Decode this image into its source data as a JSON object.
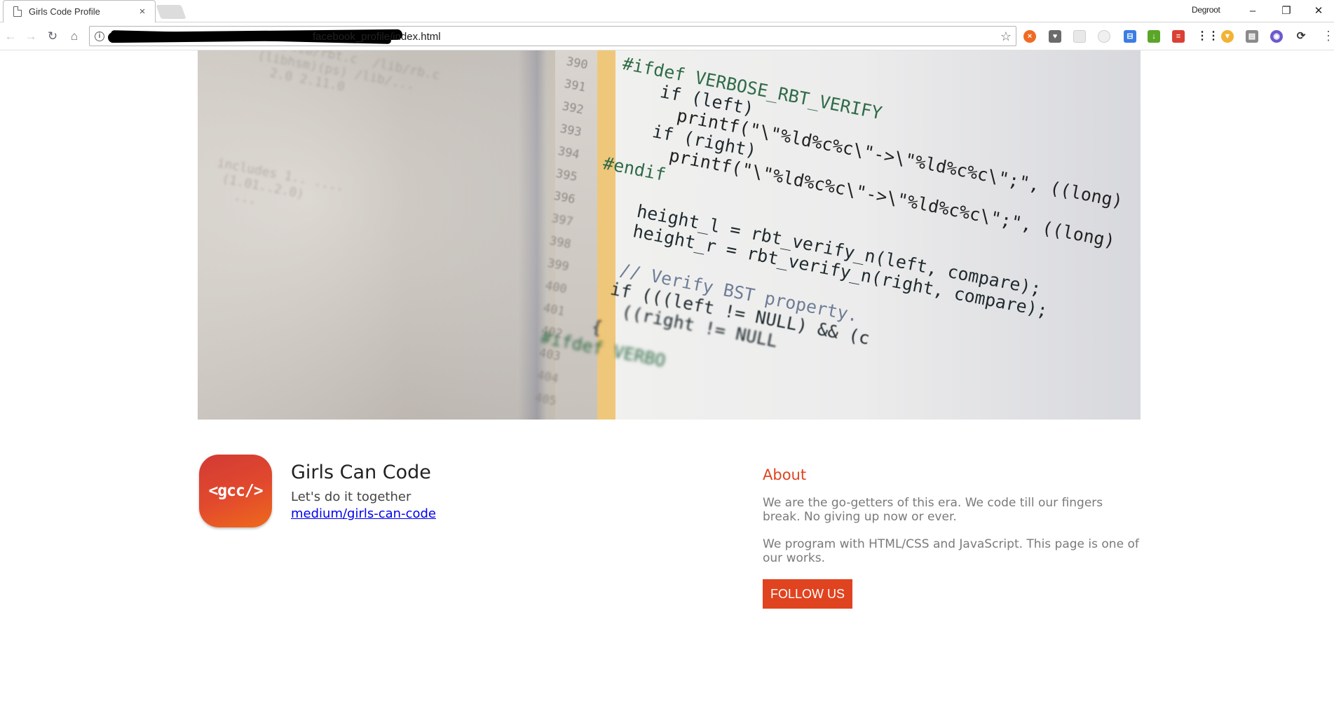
{
  "browser": {
    "tab_title": "Girls Code Profile",
    "tab_close": "×",
    "profile_name": "Degroot",
    "window_controls": {
      "minimize": "–",
      "restore": "❐",
      "close": "✕"
    },
    "url_visible": "facebook_profile/index.html"
  },
  "cover": {
    "code_lines": [
      "#ifdef VERBOSE_RBT_VERIFY",
      "    if (left)",
      "      printf(\"\\\"%ld%c%c\\\"->\\\"%ld%c%c\\\";\", ((long)",
      "    if (right)",
      "      printf(\"\\\"%ld%c%c\\\"->\\\"%ld%c%c\\\";\", ((long)",
      "#endif",
      "",
      "    height_l = rbt_verify_n(left, compare);",
      "    height_r = rbt_verify_n(right, compare);",
      "",
      "    // Verify BST property.",
      "    if (((left != NULL) && (c",
      "      ((right != NULL",
      "    {",
      "#ifdef VERBO"
    ],
    "line_numbers": [
      "390",
      "391",
      "392",
      "393",
      "394",
      "395",
      "396",
      "397",
      "398",
      "399",
      "400",
      "401",
      "402",
      "403",
      "404",
      "405"
    ]
  },
  "profile": {
    "logo_text": "<gcc/>",
    "name": "Girls Can Code",
    "tagline": "Let's do it together",
    "link": "medium/girls-can-code"
  },
  "about": {
    "heading": "About",
    "paragraphs": [
      "We are the go-getters of this era. We code till our fingers break. No giving up now or ever.",
      "We program with HTML/CSS and JavaScript. This page is one of our works."
    ],
    "follow_button": "FOLLOW US"
  },
  "colors": {
    "accent": "#e0431f",
    "link": "#0000ee",
    "body_text": "#7a7a7a"
  },
  "icons": {
    "extensions": [
      "ublock-icon",
      "pocket-icon",
      "screenshot-icon",
      "clock-icon",
      "translate-icon",
      "download-icon",
      "todoist-icon",
      "apps-grid-icon",
      "badge-icon",
      "reader-icon",
      "vpn-icon",
      "sync-icon"
    ]
  }
}
